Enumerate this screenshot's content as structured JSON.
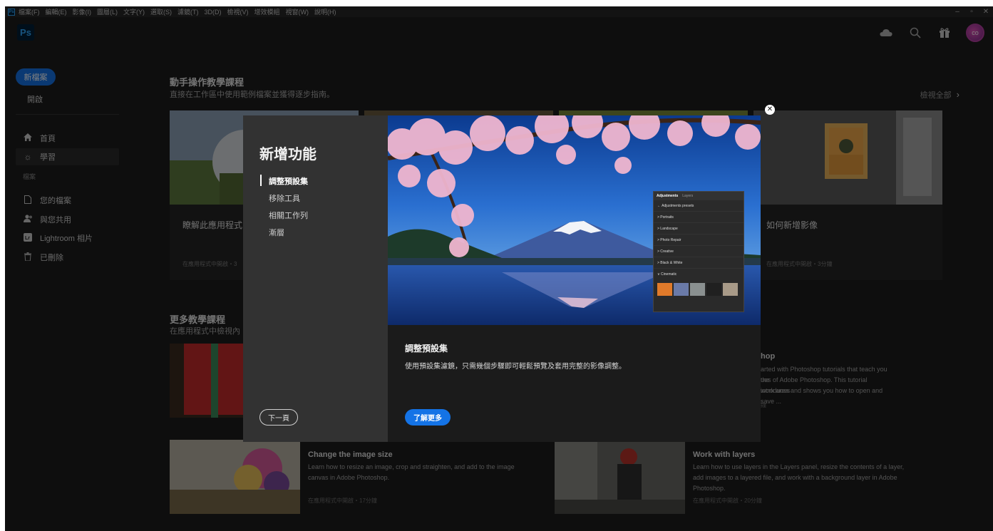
{
  "menubar": {
    "items": [
      "檔案(F)",
      "編輯(E)",
      "影像(I)",
      "圖層(L)",
      "文字(Y)",
      "選取(S)",
      "濾鏡(T)",
      "3D(D)",
      "檢視(V)",
      "增效模組",
      "視窗(W)",
      "說明(H)"
    ],
    "app_mini": "Ps"
  },
  "topbar": {
    "logo": "Ps",
    "avatar": "co"
  },
  "sidebar": {
    "new_file": "新檔案",
    "open": "開啟",
    "home": "首頁",
    "learn": "學習",
    "files_section": "檔案",
    "your_files": "您的檔案",
    "shared": "與您共用",
    "lightroom": "Lightroom 相片",
    "deleted": "已刪除"
  },
  "main": {
    "hands_on_title": "動手操作教學課程",
    "hands_on_sub": "直接在工作區中使用範例檔案並獲得逐步指南。",
    "view_all": "檢視全部",
    "cards": [
      {
        "title": "瞭解此應用程式",
        "meta": "在應用程式中開啟・3"
      },
      {
        "title": "如何新增影像",
        "meta": "在應用程式中開啟・3分鐘"
      }
    ],
    "more_title": "更多教學課程",
    "more_sub": "在應用程式中檢視內",
    "tutorials": [
      {
        "title": "hop",
        "desc": [
          "arted with Photoshop tutorials that teach you the",
          "ues of Adobe Photoshop. This tutorial introduces",
          "work area and shows you how to open and save ..."
        ],
        "meta": "鐘"
      },
      {
        "title": "Change the image size",
        "desc": [
          "Learn how to resize an image, crop and straighten, and add to the image",
          "canvas in Adobe Photoshop."
        ],
        "meta": "在應用程式中開啟・17分鐘"
      },
      {
        "title": "Work with layers",
        "desc": [
          "Learn how to use layers in the Layers panel, resize the contents of a layer,",
          "add images to a layered file, and work with a background layer in Adobe",
          "Photoshop."
        ],
        "meta": "在應用程式中開啟・20分鐘"
      }
    ]
  },
  "modal": {
    "heading": "新增功能",
    "features": [
      "調整預設集",
      "移除工具",
      "相關工作列",
      "漸層"
    ],
    "next_button": "下一頁",
    "feature_title": "調整預設集",
    "feature_desc": "使用預設集濾鏡，只需幾個步驟即可輕鬆預覽及套用完整的影像調整。",
    "learn_more": "了解更多",
    "panel": {
      "tab_active": "Adjustments",
      "tab_other": "Layers",
      "back_label": "← Adjustments presets",
      "rows": [
        "> Portraits",
        "> Landscape",
        "> Photo Repair",
        "> Creative",
        "> Black & White",
        "∨ Cinematic"
      ]
    }
  },
  "colors": {
    "accent": "#1473e6",
    "background": "#1d1d1d",
    "modal_left": "#323232"
  },
  "icons": [
    "cloud-icon",
    "search-icon",
    "gift-icon",
    "home-icon",
    "lightbulb-icon",
    "file-icon",
    "shared-user-icon",
    "lightroom-icon",
    "trash-icon",
    "close-icon",
    "chevron-right-icon"
  ]
}
